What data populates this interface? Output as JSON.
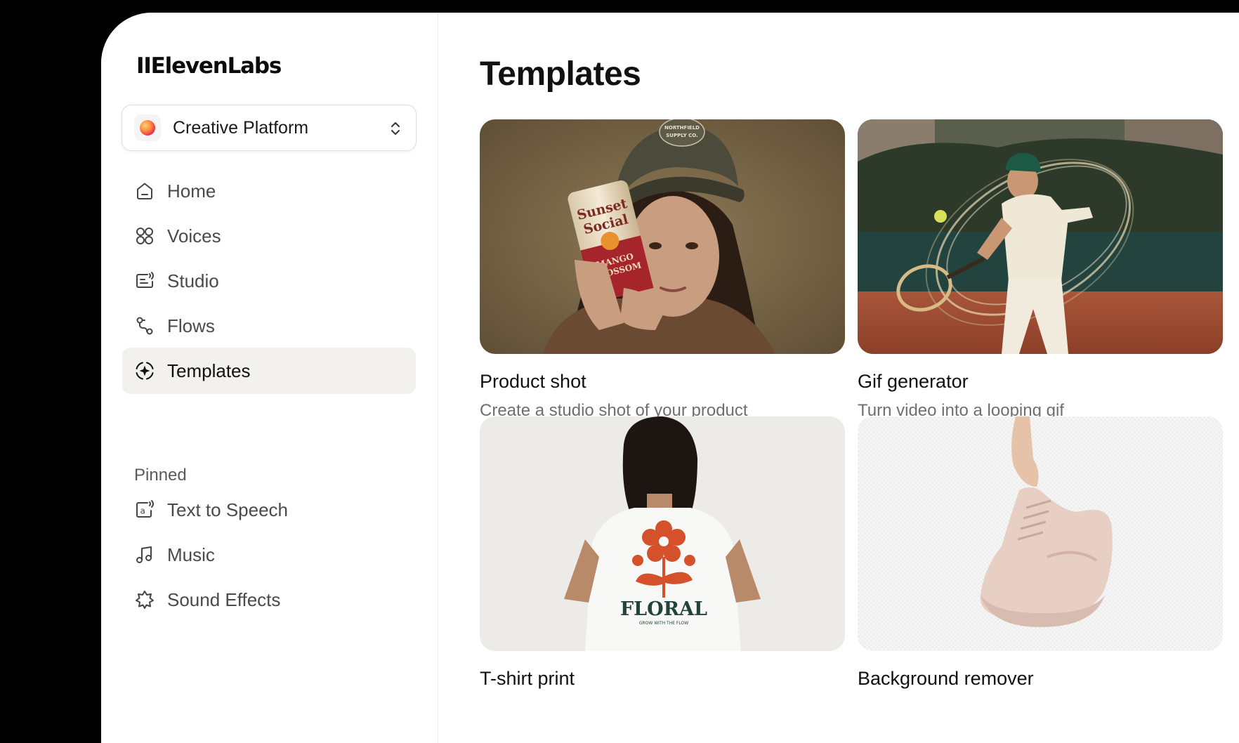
{
  "app": {
    "logo": "IIElevenLabs"
  },
  "workspace": {
    "name": "Creative Platform"
  },
  "nav": {
    "items": [
      {
        "label": "Home"
      },
      {
        "label": "Voices"
      },
      {
        "label": "Studio"
      },
      {
        "label": "Flows"
      },
      {
        "label": "Templates",
        "active": true
      }
    ],
    "pinned_label": "Pinned",
    "pinned": [
      {
        "label": "Text to Speech"
      },
      {
        "label": "Music"
      },
      {
        "label": "Sound Effects"
      }
    ]
  },
  "main": {
    "title": "Templates",
    "cards": [
      {
        "title": "Product shot",
        "description": "Create a studio shot of your product"
      },
      {
        "title": "Gif generator",
        "description": "Turn video into a looping gif"
      },
      {
        "title": "T-shirt print",
        "description": ""
      },
      {
        "title": "Background remover",
        "description": ""
      }
    ],
    "image_text": {
      "cap_patch_1": "NORTHFIELD",
      "cap_patch_2": "SUPPLY CO.",
      "can_brand_1": "Sunset",
      "can_brand_2": "Social",
      "can_flavor_1": "MANGO",
      "can_flavor_2": "BLOSSOM",
      "shirt_print": "FLORAL",
      "shirt_tagline": "GROW WITH THE FLOW"
    }
  },
  "colors": {
    "active_nav_bg": "#f2f1ef",
    "frame_bg": "#000000"
  },
  "icons": [
    "home-icon",
    "voices-icon",
    "studio-icon",
    "flows-icon",
    "templates-icon",
    "text-to-speech-icon",
    "music-icon",
    "sound-effects-icon",
    "chevron-updown-icon"
  ]
}
